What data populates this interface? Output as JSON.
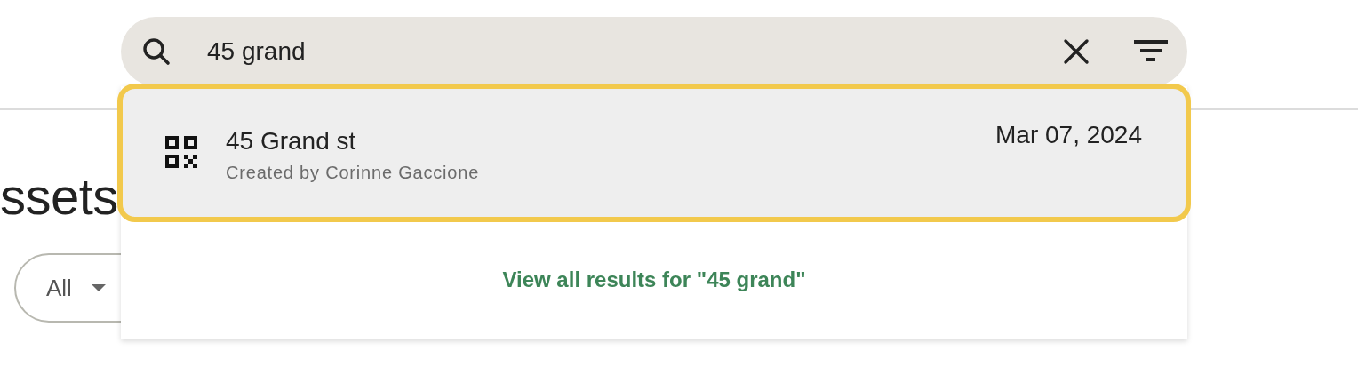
{
  "page": {
    "heading": "ssets",
    "filter_chip": {
      "label": "All"
    }
  },
  "search": {
    "value": "45 grand"
  },
  "results": [
    {
      "kind": "qr",
      "title": "45 Grand st",
      "subtitle": "Created by Corinne Gaccione",
      "date": "Mar 07, 2024",
      "selected": true
    }
  ],
  "view_all_link": "View all results for \"45 grand\""
}
